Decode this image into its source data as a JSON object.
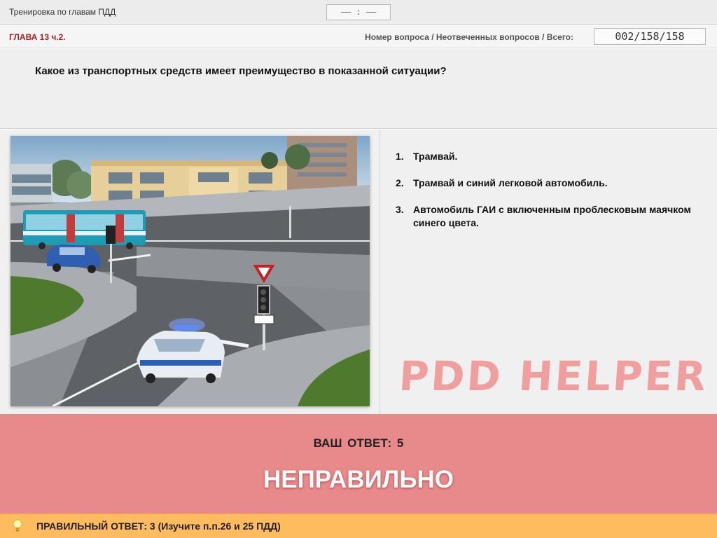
{
  "window": {
    "title": "Тренировка по главам ПДД",
    "timer": "—— : ——"
  },
  "info": {
    "chapter": "ГЛАВА 13 ч.2.",
    "question_label": "Номер вопроса / Неотвеченных вопросов / Всего:",
    "counter": "002/158/158"
  },
  "question": {
    "text": "Какое из транспортных средств имеет преимущество в показанной ситуации?"
  },
  "answers": [
    {
      "num": "1.",
      "text": "Трамвай."
    },
    {
      "num": "2.",
      "text": "Трамвай и синий легковой автомобиль."
    },
    {
      "num": "3.",
      "text": "Автомобиль ГАИ с включенным проблесковым маячком синего цвета."
    }
  ],
  "watermark": "PDD HELPER",
  "result": {
    "your_answer": "ВАШ  ОТВЕТ:   5",
    "verdict": "НЕПРАВИЛЬНО"
  },
  "hint": {
    "text": "ПРАВИЛЬНЫЙ ОТВЕТ:   3   (Изучите п.п.26 и 25 ПДД)"
  },
  "colors": {
    "result_bg": "#e8898b",
    "hint_bg": "#ffbc5e",
    "chapter_red": "#b01e1e",
    "watermark": "#f08c8c"
  }
}
